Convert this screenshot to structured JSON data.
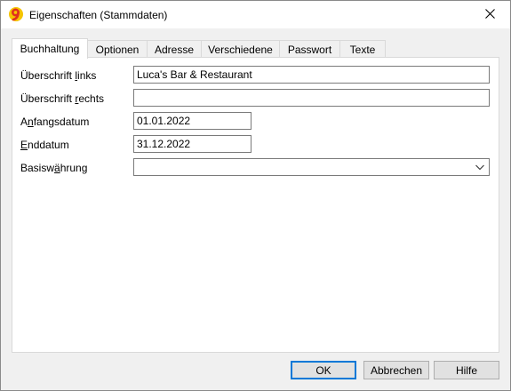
{
  "window": {
    "title": "Eigenschaften (Stammdaten)",
    "app_icon": "banana-app-icon",
    "close_icon": "close-icon"
  },
  "tabs": [
    {
      "label": "Buchhaltung",
      "active": true
    },
    {
      "label": "Optionen",
      "active": false
    },
    {
      "label": "Adresse",
      "active": false
    },
    {
      "label": "Verschiedene",
      "active": false
    },
    {
      "label": "Passwort",
      "active": false
    },
    {
      "label": "Texte",
      "active": false
    }
  ],
  "form": {
    "header_left": {
      "label_pre": "Überschrift ",
      "label_u": "l",
      "label_post": "inks",
      "value": "Luca's  Bar & Restaurant"
    },
    "header_right": {
      "label_pre": "Überschrift ",
      "label_u": "r",
      "label_post": "echts",
      "value": ""
    },
    "start_date": {
      "label_pre": "A",
      "label_u": "n",
      "label_post": "fangsdatum",
      "value": "01.01.2022"
    },
    "end_date": {
      "label_pre": "",
      "label_u": "E",
      "label_post": "nddatum",
      "value": "31.12.2022"
    },
    "base_currency": {
      "label_pre": "Basisw",
      "label_u": "ä",
      "label_post": "hrung",
      "value": ""
    }
  },
  "buttons": {
    "ok": "OK",
    "cancel": "Abbrechen",
    "help": "Hilfe"
  },
  "colors": {
    "accent": "#0078d7",
    "window_bg": "#f0f0f0",
    "panel_bg": "#ffffff"
  }
}
